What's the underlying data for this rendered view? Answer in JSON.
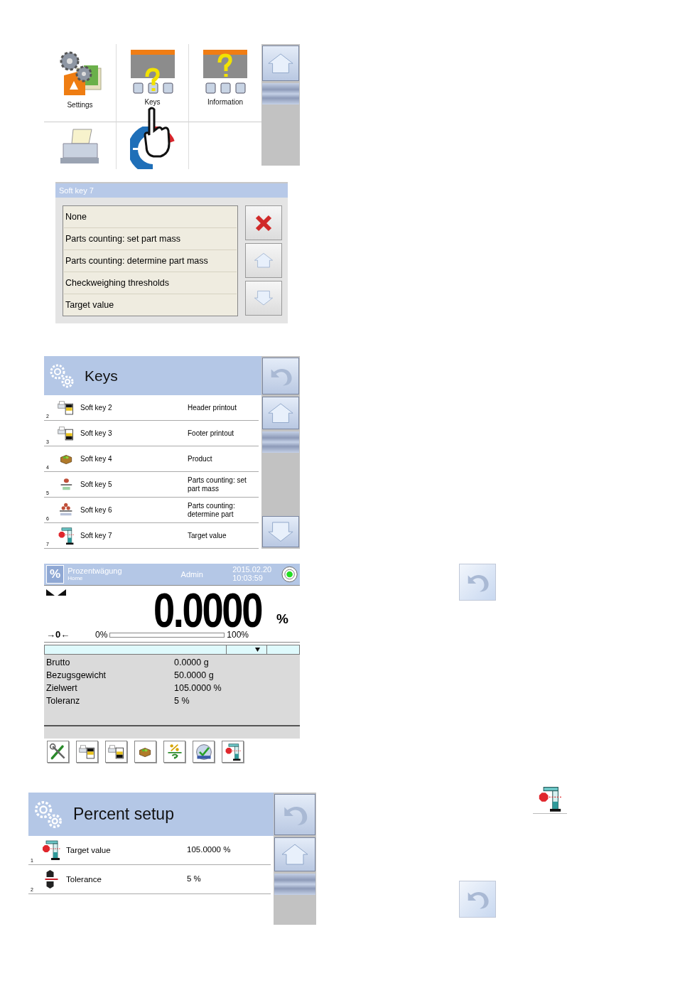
{
  "home_menu": {
    "items": [
      {
        "kind": "settings",
        "label": "Settings"
      },
      {
        "kind": "keys",
        "label": "Keys"
      },
      {
        "kind": "information",
        "label": "Information"
      },
      {
        "kind": "printer"
      },
      {
        "kind": "adjustment"
      },
      {
        "kind": "empty"
      }
    ]
  },
  "softkey_dialog": {
    "title": "Soft key 7",
    "options": [
      "None",
      "Parts counting: set part mass",
      "Parts counting: determine part mass",
      "Checkweighing thresholds",
      "Target value"
    ]
  },
  "keys_screen": {
    "title": "Keys",
    "rows": [
      {
        "number": "2",
        "kind": "header",
        "name": "Soft key 2",
        "value": "Header printout"
      },
      {
        "number": "3",
        "kind": "footer",
        "name": "Soft key 3",
        "value": "Footer printout"
      },
      {
        "number": "4",
        "kind": "product",
        "name": "Soft key 4",
        "value": "Product"
      },
      {
        "number": "5",
        "kind": "set_mass",
        "name": "Soft key 5",
        "value": "Parts counting: set part mass"
      },
      {
        "number": "6",
        "kind": "determine_mass",
        "name": "Soft key 6",
        "value": "Parts counting: determine part"
      },
      {
        "number": "7",
        "kind": "target",
        "name": "Soft key 7",
        "value": "Target value"
      }
    ]
  },
  "weighing_screen": {
    "mode_symbol": "%",
    "mode": "Prozentwägung",
    "profile": "Home",
    "user": "Admin",
    "date": "2015.02.20",
    "time": "10:03:59",
    "zero_mark": "→0←",
    "reading": "0.0000",
    "unit": "%",
    "bar_min": "0%",
    "bar_max": "100%",
    "info": [
      {
        "label": "Brutto",
        "value": "0.0000 g"
      },
      {
        "label": "Bezugsgewicht",
        "value": "50.0000 g"
      },
      {
        "label": "Zielwert",
        "value": "105.0000 %"
      },
      {
        "label": "Toleranz",
        "value": "5 %"
      }
    ],
    "toolbar": [
      {
        "kind": "tools"
      },
      {
        "kind": "header"
      },
      {
        "kind": "footer"
      },
      {
        "kind": "product"
      },
      {
        "kind": "percent"
      },
      {
        "kind": "reference"
      },
      {
        "kind": "target"
      }
    ]
  },
  "percent_setup": {
    "title": "Percent setup",
    "rows": [
      {
        "number": "1",
        "kind": "target",
        "name": "Target value",
        "value": "105.0000 %"
      },
      {
        "number": "2",
        "kind": "tolerance",
        "name": "Tolerance",
        "value": "5 %"
      }
    ]
  }
}
